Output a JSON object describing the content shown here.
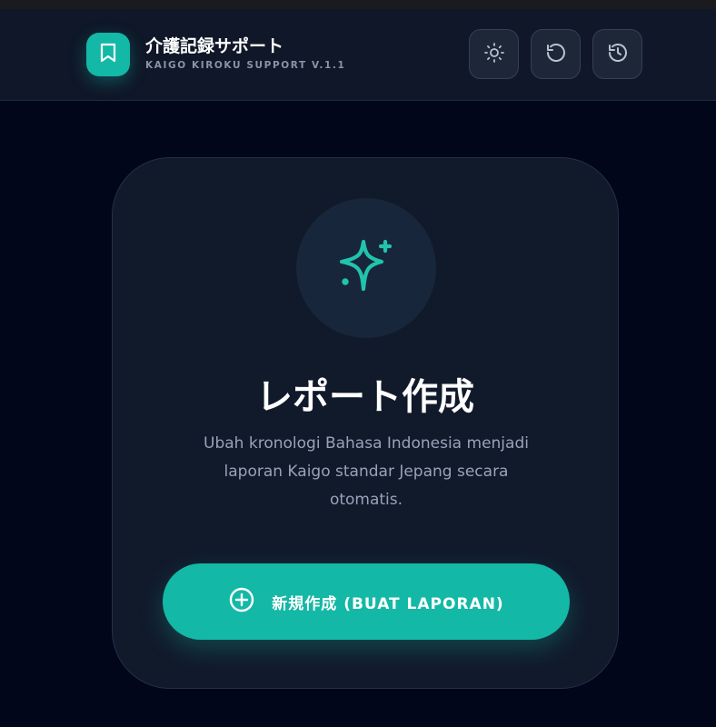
{
  "header": {
    "title": "介護記録サポート",
    "subtitle": "KAIGO KIROKU SUPPORT V.1.1",
    "logo_icon": "bookmark-icon",
    "buttons": [
      {
        "icon": "sun-icon"
      },
      {
        "icon": "reset-icon"
      },
      {
        "icon": "history-icon"
      }
    ]
  },
  "card": {
    "icon": "sparkles-icon",
    "title": "レポート作成",
    "description": "Ubah kronologi Bahasa Indonesia menjadi laporan Kaigo standar Jepang secara otomatis.",
    "cta_label": "新規作成 (BUAT LAPORAN)",
    "cta_icon": "plus-circle-icon"
  },
  "colors": {
    "accent": "#14b8a6",
    "background": "#02061a",
    "card": "#111a2b",
    "header": "#0f1728"
  }
}
